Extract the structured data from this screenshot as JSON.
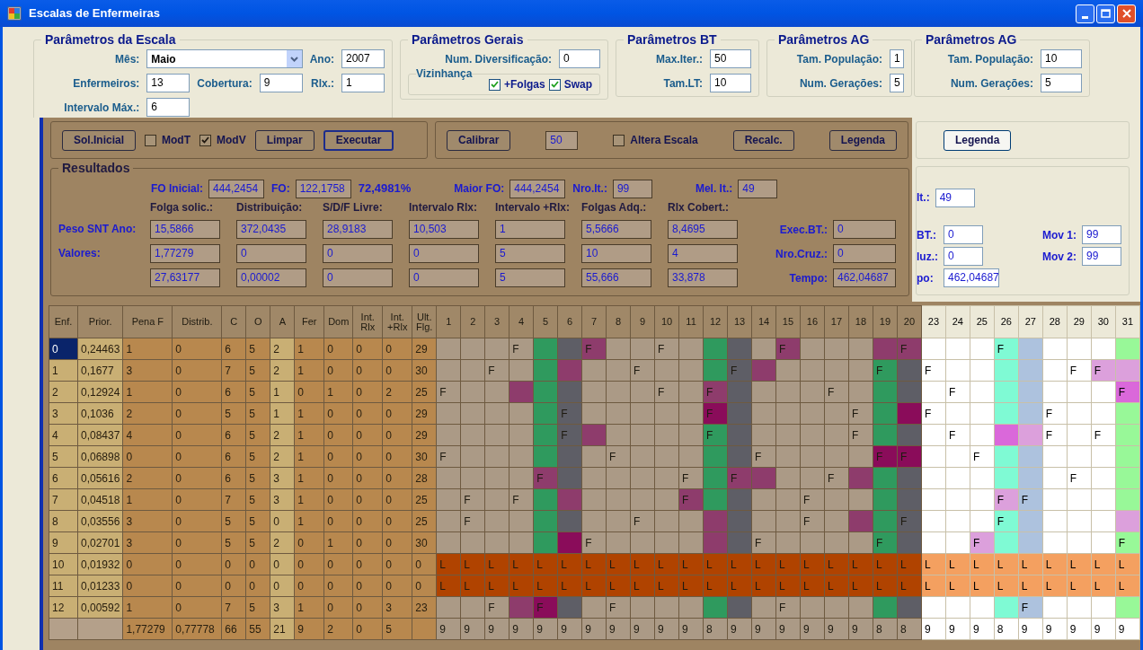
{
  "window": {
    "title": "Escalas de Enfermeiras"
  },
  "parameter_groups": [
    {
      "kind": "escala",
      "title": "Parâmetros da Escala",
      "fields": [
        {
          "label": "Mês:",
          "value": "Maio",
          "kind": "select"
        },
        {
          "label": "Ano:",
          "value": "2007",
          "kind": "text"
        },
        {
          "label": "Enfermeiros:",
          "value": "13",
          "kind": "text"
        },
        {
          "label": "Cobertura:",
          "value": "9",
          "kind": "text"
        },
        {
          "label": "Rlx.:",
          "value": "1",
          "kind": "text"
        },
        {
          "label": "Intervalo Máx.:",
          "value": "6",
          "kind": "text"
        }
      ]
    },
    {
      "kind": "gerais",
      "title": "Parâmetros Gerais",
      "fields": [
        {
          "label": "Num. Diversificação:",
          "value": "0",
          "kind": "text"
        }
      ],
      "vizinhanca": {
        "title": "Vizinhança",
        "options": [
          {
            "label": "+Folgas",
            "checked": true
          },
          {
            "label": "Swap",
            "checked": true
          }
        ]
      }
    },
    {
      "kind": "bt",
      "title": "Parâmetros BT",
      "fields": [
        {
          "label": "Max.Iter.:",
          "value": "50",
          "kind": "text"
        },
        {
          "label": "Tam.LT:",
          "value": "10",
          "kind": "text"
        }
      ]
    },
    {
      "kind": "ag_hidden",
      "title": "Parâmetros AG",
      "fields": [
        {
          "label": "Tam. População:",
          "value": "1",
          "kind": "text"
        },
        {
          "label": "Num. Gerações:",
          "value": "5",
          "kind": "text"
        }
      ]
    },
    {
      "kind": "ag",
      "title": "Parâmetros AG",
      "fields": [
        {
          "label": "Tam. População:",
          "value": "10",
          "kind": "text"
        },
        {
          "label": "Num. Gerações:",
          "value": "5",
          "kind": "text"
        }
      ]
    }
  ],
  "controls": [
    {
      "items": [
        {
          "kind": "button",
          "label": "Sol.Inicial",
          "selected": false
        },
        {
          "kind": "checkbox",
          "label": "ModT",
          "checked": false
        },
        {
          "kind": "checkbox",
          "label": "ModV",
          "checked": true
        },
        {
          "kind": "button",
          "label": "Limpar",
          "selected": false
        },
        {
          "kind": "button",
          "label": "Executar",
          "selected": true
        }
      ]
    },
    {
      "items": [
        {
          "kind": "button",
          "label": "Calibrar",
          "selected": false
        },
        {
          "kind": "field",
          "value": "50"
        },
        {
          "kind": "checkbox",
          "label": "Altera Escala",
          "checked": false
        },
        {
          "kind": "button",
          "label": "Recalc.",
          "selected": false
        },
        {
          "kind": "button",
          "label": "Legenda",
          "selected": false
        }
      ]
    }
  ],
  "legend_button": "Legenda",
  "results": {
    "title": "Resultados",
    "summary": [
      {
        "kind": "field",
        "label": "FO Inicial:",
        "value": "444,2454"
      },
      {
        "kind": "field",
        "label": "FO:",
        "value": "122,1758"
      },
      {
        "kind": "text",
        "value": "72,4981%"
      },
      {
        "kind": "field",
        "label": "Maior FO:",
        "value": "444,2454"
      },
      {
        "kind": "field",
        "label": "Nro.It.:",
        "value": "99"
      },
      {
        "kind": "field",
        "label": "Mel. It.:",
        "value": "49"
      }
    ],
    "columns": [
      "Folga solic.:",
      "Distribuição:",
      "S/D/F Livre:",
      "Intervalo Rlx:",
      "Intervalo +Rlx:",
      "Folgas Adq.:",
      "Rlx Cobert.:"
    ],
    "rows": [
      {
        "label": "Peso SNT Ano:",
        "values": [
          "15,5866",
          "372,0435",
          "28,9183",
          "10,503",
          "1",
          "5,5666",
          "8,4695"
        ],
        "side_label": "Exec.BT.:",
        "side_value": "0"
      },
      {
        "label": "Valores:",
        "values": [
          "1,77279",
          "0",
          "0",
          "0",
          "5",
          "10",
          "4"
        ],
        "side_label": "Nro.Cruz.:",
        "side_value": "0"
      },
      {
        "values": [
          "27,63177",
          "0,00002",
          "0",
          "0",
          "5",
          "55,666",
          "33,878"
        ],
        "side_label": "Tempo:",
        "side_value": "462,04687"
      }
    ]
  },
  "side_results": {
    "top": {
      "label": "It.:",
      "value": "49"
    },
    "rows": [
      {
        "label": "BT.:",
        "value": "0",
        "mov_label": "Mov 1:",
        "mov_value": "99"
      },
      {
        "label": "luz.:",
        "value": "0",
        "mov_label": "Mov 2:",
        "mov_value": "99"
      },
      {
        "label": "po:",
        "value": "462,04687"
      }
    ]
  },
  "table": {
    "columns": [
      "Enf.",
      "Prior.",
      "Pena F",
      "Distrib.",
      "C",
      "O",
      "A",
      "Fer",
      "Dom",
      "Int. Rlx",
      "Int. +Rlx",
      "Ult. Flg.",
      "1",
      "2",
      "3",
      "4",
      "5",
      "6",
      "7",
      "8",
      "9",
      "10",
      "11",
      "12",
      "13",
      "14",
      "15",
      "16",
      "17",
      "18",
      "19",
      "20",
      "23",
      "24",
      "25",
      "26",
      "27",
      "28",
      "29",
      "30",
      "31"
    ],
    "rows": [
      {
        "selected": true,
        "cells": [
          "0",
          "0,24463",
          "1",
          "0",
          "6",
          "5",
          "2",
          "1",
          "0",
          "0",
          "0",
          "29"
        ],
        "days": [
          {
            "color": "#ab9a86"
          },
          {
            "color": "#ab9a86"
          },
          {
            "color": "#ab9a86"
          },
          {
            "text": "F",
            "color": "#ab9a86"
          },
          {
            "color": "#2f9a5e"
          },
          {
            "color": "#5e5e66"
          },
          {
            "text": "F",
            "color": "#8e3c6c"
          },
          {
            "color": "#ab9a86"
          },
          {
            "color": "#ab9a86"
          },
          {
            "text": "F",
            "color": "#ab9a86"
          },
          {
            "color": "#ab9a86"
          },
          {
            "color": "#2f9a5e"
          },
          {
            "color": "#5e5e66"
          },
          {
            "color": "#ab9a86"
          },
          {
            "text": "F",
            "color": "#8e3c6c"
          },
          {
            "color": "#ab9a86"
          },
          {
            "color": "#ab9a86"
          },
          {
            "color": "#ab9a86"
          },
          {
            "color": "#8e3c6c"
          },
          {
            "text": "F",
            "color": "#8e3c6c"
          },
          {
            "color": "#ffffff"
          },
          {
            "color": "#ffffff"
          },
          {
            "color": "#ffffff"
          },
          {
            "text": "F",
            "color": "#7ffad4"
          },
          {
            "color": "#adc2de"
          },
          {
            "color": "#ffffff"
          },
          {
            "color": "#ffffff"
          },
          {
            "color": "#ffffff"
          },
          {
            "color": "#98f898"
          }
        ]
      },
      {
        "selected": false,
        "cells": [
          "1",
          "0,1677",
          "3",
          "0",
          "7",
          "5",
          "2",
          "1",
          "0",
          "0",
          "0",
          "30"
        ],
        "days": [
          {
            "color": "#ab9a86"
          },
          {
            "color": "#ab9a86"
          },
          {
            "text": "F",
            "color": "#ab9a86"
          },
          {
            "color": "#ab9a86"
          },
          {
            "color": "#2f9a5e"
          },
          {
            "color": "#8e3c6c"
          },
          {
            "color": "#ab9a86"
          },
          {
            "color": "#ab9a86"
          },
          {
            "text": "F",
            "color": "#ab9a86"
          },
          {
            "color": "#ab9a86"
          },
          {
            "color": "#ab9a86"
          },
          {
            "color": "#2f9a5e"
          },
          {
            "text": "F",
            "color": "#5e5e66"
          },
          {
            "color": "#8e3c6c"
          },
          {
            "color": "#ab9a86"
          },
          {
            "color": "#ab9a86"
          },
          {
            "color": "#ab9a86"
          },
          {
            "color": "#ab9a86"
          },
          {
            "text": "F",
            "color": "#2f9a5e"
          },
          {
            "color": "#5e5e66"
          },
          {
            "text": "F",
            "color": "#ffffff"
          },
          {
            "color": "#ffffff"
          },
          {
            "color": "#ffffff"
          },
          {
            "color": "#7ffad4"
          },
          {
            "color": "#adc2de"
          },
          {
            "color": "#ffffff"
          },
          {
            "text": "F",
            "color": "#ffffff"
          },
          {
            "text": "F",
            "color": "#dca0dc"
          },
          {
            "color": "#dca0dc"
          }
        ]
      },
      {
        "selected": false,
        "cells": [
          "2",
          "0,12924",
          "1",
          "0",
          "6",
          "5",
          "1",
          "0",
          "1",
          "0",
          "2",
          "25"
        ],
        "days": [
          {
            "text": "F",
            "color": "#ab9a86"
          },
          {
            "color": "#ab9a86"
          },
          {
            "color": "#ab9a86"
          },
          {
            "color": "#8e3c6c"
          },
          {
            "color": "#2f9a5e"
          },
          {
            "color": "#5e5e66"
          },
          {
            "color": "#ab9a86"
          },
          {
            "color": "#ab9a86"
          },
          {
            "color": "#ab9a86"
          },
          {
            "text": "F",
            "color": "#ab9a86"
          },
          {
            "color": "#ab9a86"
          },
          {
            "text": "F",
            "color": "#8e3c6c"
          },
          {
            "color": "#5e5e66"
          },
          {
            "color": "#ab9a86"
          },
          {
            "color": "#ab9a86"
          },
          {
            "color": "#ab9a86"
          },
          {
            "text": "F",
            "color": "#ab9a86"
          },
          {
            "color": "#ab9a86"
          },
          {
            "color": "#2f9a5e"
          },
          {
            "color": "#5e5e66"
          },
          {
            "color": "#ffffff"
          },
          {
            "text": "F",
            "color": "#ffffff"
          },
          {
            "color": "#ffffff"
          },
          {
            "color": "#7ffad4"
          },
          {
            "color": "#adc2de"
          },
          {
            "color": "#ffffff"
          },
          {
            "color": "#ffffff"
          },
          {
            "color": "#ffffff"
          },
          {
            "text": "F",
            "color": "#da68da"
          }
        ]
      },
      {
        "selected": false,
        "cells": [
          "3",
          "0,1036",
          "2",
          "0",
          "5",
          "5",
          "1",
          "1",
          "0",
          "0",
          "0",
          "29"
        ],
        "days": [
          {
            "color": "#ab9a86"
          },
          {
            "color": "#ab9a86"
          },
          {
            "color": "#ab9a86"
          },
          {
            "color": "#ab9a86"
          },
          {
            "color": "#2f9a5e"
          },
          {
            "text": "F",
            "color": "#5e5e66"
          },
          {
            "color": "#ab9a86"
          },
          {
            "color": "#ab9a86"
          },
          {
            "color": "#ab9a86"
          },
          {
            "color": "#ab9a86"
          },
          {
            "color": "#ab9a86"
          },
          {
            "text": "F",
            "color": "#8a0c5a"
          },
          {
            "color": "#5e5e66"
          },
          {
            "color": "#ab9a86"
          },
          {
            "color": "#ab9a86"
          },
          {
            "color": "#ab9a86"
          },
          {
            "color": "#ab9a86"
          },
          {
            "text": "F",
            "color": "#ab9a86"
          },
          {
            "color": "#2f9a5e"
          },
          {
            "color": "#8a0c5a"
          },
          {
            "text": "F",
            "color": "#ffffff"
          },
          {
            "color": "#ffffff"
          },
          {
            "color": "#ffffff"
          },
          {
            "color": "#7ffad4"
          },
          {
            "color": "#adc2de"
          },
          {
            "text": "F",
            "color": "#ffffff"
          },
          {
            "color": "#ffffff"
          },
          {
            "color": "#ffffff"
          },
          {
            "color": "#98f898"
          }
        ]
      },
      {
        "selected": false,
        "cells": [
          "4",
          "0,08437",
          "4",
          "0",
          "6",
          "5",
          "2",
          "1",
          "0",
          "0",
          "0",
          "29"
        ],
        "days": [
          {
            "color": "#ab9a86"
          },
          {
            "color": "#ab9a86"
          },
          {
            "color": "#ab9a86"
          },
          {
            "color": "#ab9a86"
          },
          {
            "color": "#2f9a5e"
          },
          {
            "text": "F",
            "color": "#5e5e66"
          },
          {
            "color": "#8e3c6c"
          },
          {
            "color": "#ab9a86"
          },
          {
            "color": "#ab9a86"
          },
          {
            "color": "#ab9a86"
          },
          {
            "color": "#ab9a86"
          },
          {
            "text": "F",
            "color": "#2f9a5e"
          },
          {
            "color": "#5e5e66"
          },
          {
            "color": "#ab9a86"
          },
          {
            "color": "#ab9a86"
          },
          {
            "color": "#ab9a86"
          },
          {
            "color": "#ab9a86"
          },
          {
            "text": "F",
            "color": "#ab9a86"
          },
          {
            "color": "#2f9a5e"
          },
          {
            "color": "#5e5e66"
          },
          {
            "color": "#ffffff"
          },
          {
            "text": "F",
            "color": "#ffffff"
          },
          {
            "color": "#ffffff"
          },
          {
            "color": "#da68da"
          },
          {
            "color": "#dca0dc"
          },
          {
            "text": "F",
            "color": "#ffffff"
          },
          {
            "color": "#ffffff"
          },
          {
            "text": "F",
            "color": "#ffffff"
          },
          {
            "color": "#98f898"
          }
        ]
      },
      {
        "selected": false,
        "cells": [
          "5",
          "0,06898",
          "0",
          "0",
          "6",
          "5",
          "2",
          "1",
          "0",
          "0",
          "0",
          "30"
        ],
        "days": [
          {
            "text": "F",
            "color": "#ab9a86"
          },
          {
            "color": "#ab9a86"
          },
          {
            "color": "#ab9a86"
          },
          {
            "color": "#ab9a86"
          },
          {
            "color": "#2f9a5e"
          },
          {
            "color": "#5e5e66"
          },
          {
            "color": "#ab9a86"
          },
          {
            "text": "F",
            "color": "#ab9a86"
          },
          {
            "color": "#ab9a86"
          },
          {
            "color": "#ab9a86"
          },
          {
            "color": "#ab9a86"
          },
          {
            "color": "#2f9a5e"
          },
          {
            "color": "#5e5e66"
          },
          {
            "text": "F",
            "color": "#ab9a86"
          },
          {
            "color": "#ab9a86"
          },
          {
            "color": "#ab9a86"
          },
          {
            "color": "#ab9a86"
          },
          {
            "color": "#ab9a86"
          },
          {
            "text": "F",
            "color": "#8a0c5a"
          },
          {
            "text": "F",
            "color": "#8a0c5a"
          },
          {
            "color": "#ffffff"
          },
          {
            "color": "#ffffff"
          },
          {
            "text": "F",
            "color": "#ffffff"
          },
          {
            "color": "#7ffad4"
          },
          {
            "color": "#adc2de"
          },
          {
            "color": "#ffffff"
          },
          {
            "color": "#ffffff"
          },
          {
            "color": "#ffffff"
          },
          {
            "color": "#98f898"
          }
        ]
      },
      {
        "selected": false,
        "cells": [
          "6",
          "0,05616",
          "2",
          "0",
          "6",
          "5",
          "3",
          "1",
          "0",
          "0",
          "0",
          "28"
        ],
        "days": [
          {
            "color": "#ab9a86"
          },
          {
            "color": "#ab9a86"
          },
          {
            "color": "#ab9a86"
          },
          {
            "color": "#ab9a86"
          },
          {
            "text": "F",
            "color": "#8e3c6c"
          },
          {
            "color": "#5e5e66"
          },
          {
            "color": "#ab9a86"
          },
          {
            "color": "#ab9a86"
          },
          {
            "color": "#ab9a86"
          },
          {
            "color": "#ab9a86"
          },
          {
            "text": "F",
            "color": "#ab9a86"
          },
          {
            "color": "#2f9a5e"
          },
          {
            "text": "F",
            "color": "#8e3c6c"
          },
          {
            "color": "#8e3c6c"
          },
          {
            "color": "#ab9a86"
          },
          {
            "color": "#ab9a86"
          },
          {
            "text": "F",
            "color": "#ab9a86"
          },
          {
            "color": "#8e3c6c"
          },
          {
            "color": "#2f9a5e"
          },
          {
            "color": "#5e5e66"
          },
          {
            "color": "#ffffff"
          },
          {
            "color": "#ffffff"
          },
          {
            "color": "#ffffff"
          },
          {
            "color": "#7ffad4"
          },
          {
            "color": "#adc2de"
          },
          {
            "color": "#ffffff"
          },
          {
            "text": "F",
            "color": "#ffffff"
          },
          {
            "color": "#ffffff"
          },
          {
            "color": "#98f898"
          }
        ]
      },
      {
        "selected": false,
        "cells": [
          "7",
          "0,04518",
          "1",
          "0",
          "7",
          "5",
          "3",
          "1",
          "0",
          "0",
          "0",
          "25"
        ],
        "days": [
          {
            "color": "#ab9a86"
          },
          {
            "text": "F",
            "color": "#ab9a86"
          },
          {
            "color": "#ab9a86"
          },
          {
            "text": "F",
            "color": "#ab9a86"
          },
          {
            "color": "#2f9a5e"
          },
          {
            "color": "#8e3c6c"
          },
          {
            "color": "#ab9a86"
          },
          {
            "color": "#ab9a86"
          },
          {
            "color": "#ab9a86"
          },
          {
            "color": "#ab9a86"
          },
          {
            "text": "F",
            "color": "#8e3c6c"
          },
          {
            "color": "#2f9a5e"
          },
          {
            "color": "#5e5e66"
          },
          {
            "color": "#ab9a86"
          },
          {
            "color": "#ab9a86"
          },
          {
            "text": "F",
            "color": "#ab9a86"
          },
          {
            "color": "#ab9a86"
          },
          {
            "color": "#ab9a86"
          },
          {
            "color": "#2f9a5e"
          },
          {
            "color": "#5e5e66"
          },
          {
            "color": "#ffffff"
          },
          {
            "color": "#ffffff"
          },
          {
            "color": "#ffffff"
          },
          {
            "text": "F",
            "color": "#dca0dc"
          },
          {
            "text": "F",
            "color": "#adc2de"
          },
          {
            "color": "#ffffff"
          },
          {
            "color": "#ffffff"
          },
          {
            "color": "#ffffff"
          },
          {
            "color": "#98f898"
          }
        ]
      },
      {
        "selected": false,
        "cells": [
          "8",
          "0,03556",
          "3",
          "0",
          "5",
          "5",
          "0",
          "1",
          "0",
          "0",
          "0",
          "25"
        ],
        "days": [
          {
            "color": "#ab9a86"
          },
          {
            "text": "F",
            "color": "#ab9a86"
          },
          {
            "color": "#ab9a86"
          },
          {
            "color": "#ab9a86"
          },
          {
            "color": "#2f9a5e"
          },
          {
            "color": "#5e5e66"
          },
          {
            "color": "#ab9a86"
          },
          {
            "color": "#ab9a86"
          },
          {
            "text": "F",
            "color": "#ab9a86"
          },
          {
            "color": "#ab9a86"
          },
          {
            "color": "#ab9a86"
          },
          {
            "color": "#8e3c6c"
          },
          {
            "color": "#5e5e66"
          },
          {
            "color": "#ab9a86"
          },
          {
            "color": "#ab9a86"
          },
          {
            "text": "F",
            "color": "#ab9a86"
          },
          {
            "color": "#ab9a86"
          },
          {
            "color": "#8e3c6c"
          },
          {
            "color": "#2f9a5e"
          },
          {
            "text": "F",
            "color": "#5e5e66"
          },
          {
            "color": "#ffffff"
          },
          {
            "color": "#ffffff"
          },
          {
            "color": "#ffffff"
          },
          {
            "text": "F",
            "color": "#7ffad4"
          },
          {
            "color": "#adc2de"
          },
          {
            "color": "#ffffff"
          },
          {
            "color": "#ffffff"
          },
          {
            "color": "#ffffff"
          },
          {
            "color": "#dca0dc"
          }
        ]
      },
      {
        "selected": false,
        "cells": [
          "9",
          "0,02701",
          "3",
          "0",
          "5",
          "5",
          "2",
          "0",
          "1",
          "0",
          "0",
          "30"
        ],
        "days": [
          {
            "color": "#ab9a86"
          },
          {
            "color": "#ab9a86"
          },
          {
            "color": "#ab9a86"
          },
          {
            "color": "#ab9a86"
          },
          {
            "color": "#2f9a5e"
          },
          {
            "color": "#8a0c5a"
          },
          {
            "text": "F",
            "color": "#ab9a86"
          },
          {
            "color": "#ab9a86"
          },
          {
            "color": "#ab9a86"
          },
          {
            "color": "#ab9a86"
          },
          {
            "color": "#ab9a86"
          },
          {
            "color": "#8e3c6c"
          },
          {
            "color": "#5e5e66"
          },
          {
            "text": "F",
            "color": "#ab9a86"
          },
          {
            "color": "#ab9a86"
          },
          {
            "color": "#ab9a86"
          },
          {
            "color": "#ab9a86"
          },
          {
            "color": "#ab9a86"
          },
          {
            "text": "F",
            "color": "#2f9a5e"
          },
          {
            "color": "#5e5e66"
          },
          {
            "color": "#ffffff"
          },
          {
            "color": "#ffffff"
          },
          {
            "text": "F",
            "color": "#dca0dc"
          },
          {
            "color": "#7ffad4"
          },
          {
            "color": "#adc2de"
          },
          {
            "color": "#ffffff"
          },
          {
            "color": "#ffffff"
          },
          {
            "color": "#ffffff"
          },
          {
            "text": "F",
            "color": "#98f898"
          }
        ]
      },
      {
        "selected": false,
        "cells": [
          "10",
          "0,01932",
          "0",
          "0",
          "0",
          "0",
          "0",
          "0",
          "0",
          "0",
          "0",
          "0"
        ],
        "days": [
          {
            "text": "L",
            "color": "#b04300"
          },
          {
            "text": "L",
            "color": "#b04300"
          },
          {
            "text": "L",
            "color": "#b04300"
          },
          {
            "text": "L",
            "color": "#b04300"
          },
          {
            "text": "L",
            "color": "#b04300"
          },
          {
            "text": "L",
            "color": "#b04300"
          },
          {
            "text": "L",
            "color": "#b04300"
          },
          {
            "text": "L",
            "color": "#b04300"
          },
          {
            "text": "L",
            "color": "#b04300"
          },
          {
            "text": "L",
            "color": "#b04300"
          },
          {
            "text": "L",
            "color": "#b04300"
          },
          {
            "text": "L",
            "color": "#b04300"
          },
          {
            "text": "L",
            "color": "#b04300"
          },
          {
            "text": "L",
            "color": "#b04300"
          },
          {
            "text": "L",
            "color": "#b04300"
          },
          {
            "text": "L",
            "color": "#b04300"
          },
          {
            "text": "L",
            "color": "#b04300"
          },
          {
            "text": "L",
            "color": "#b04300"
          },
          {
            "text": "L",
            "color": "#b04300"
          },
          {
            "text": "L",
            "color": "#b04300"
          },
          {
            "text": "L",
            "color": "#f4a060"
          },
          {
            "text": "L",
            "color": "#f4a060"
          },
          {
            "text": "L",
            "color": "#f4a060"
          },
          {
            "text": "L",
            "color": "#f4a060"
          },
          {
            "text": "L",
            "color": "#f4a060"
          },
          {
            "text": "L",
            "color": "#f4a060"
          },
          {
            "text": "L",
            "color": "#f4a060"
          },
          {
            "text": "L",
            "color": "#f4a060"
          },
          {
            "text": "L",
            "color": "#f4a060"
          }
        ]
      },
      {
        "selected": false,
        "cells": [
          "11",
          "0,01233",
          "0",
          "0",
          "0",
          "0",
          "0",
          "0",
          "0",
          "0",
          "0",
          "0"
        ],
        "days": [
          {
            "text": "L",
            "color": "#b04300"
          },
          {
            "text": "L",
            "color": "#b04300"
          },
          {
            "text": "L",
            "color": "#b04300"
          },
          {
            "text": "L",
            "color": "#b04300"
          },
          {
            "text": "L",
            "color": "#b04300"
          },
          {
            "text": "L",
            "color": "#b04300"
          },
          {
            "text": "L",
            "color": "#b04300"
          },
          {
            "text": "L",
            "color": "#b04300"
          },
          {
            "text": "L",
            "color": "#b04300"
          },
          {
            "text": "L",
            "color": "#b04300"
          },
          {
            "text": "L",
            "color": "#b04300"
          },
          {
            "text": "L",
            "color": "#b04300"
          },
          {
            "text": "L",
            "color": "#b04300"
          },
          {
            "text": "L",
            "color": "#b04300"
          },
          {
            "text": "L",
            "color": "#b04300"
          },
          {
            "text": "L",
            "color": "#b04300"
          },
          {
            "text": "L",
            "color": "#b04300"
          },
          {
            "text": "L",
            "color": "#b04300"
          },
          {
            "text": "L",
            "color": "#b04300"
          },
          {
            "text": "L",
            "color": "#b04300"
          },
          {
            "text": "L",
            "color": "#f4a060"
          },
          {
            "text": "L",
            "color": "#f4a060"
          },
          {
            "text": "L",
            "color": "#f4a060"
          },
          {
            "text": "L",
            "color": "#f4a060"
          },
          {
            "text": "L",
            "color": "#f4a060"
          },
          {
            "text": "L",
            "color": "#f4a060"
          },
          {
            "text": "L",
            "color": "#f4a060"
          },
          {
            "text": "L",
            "color": "#f4a060"
          },
          {
            "text": "L",
            "color": "#f4a060"
          }
        ]
      },
      {
        "selected": false,
        "cells": [
          "12",
          "0,00592",
          "1",
          "0",
          "7",
          "5",
          "3",
          "1",
          "0",
          "0",
          "3",
          "23"
        ],
        "days": [
          {
            "color": "#ab9a86"
          },
          {
            "color": "#ab9a86"
          },
          {
            "text": "F",
            "color": "#ab9a86"
          },
          {
            "color": "#8e3c6c"
          },
          {
            "text": "F",
            "color": "#8a0c5a"
          },
          {
            "color": "#5e5e66"
          },
          {
            "color": "#ab9a86"
          },
          {
            "text": "F",
            "color": "#ab9a86"
          },
          {
            "color": "#ab9a86"
          },
          {
            "color": "#ab9a86"
          },
          {
            "color": "#ab9a86"
          },
          {
            "color": "#2f9a5e"
          },
          {
            "color": "#5e5e66"
          },
          {
            "color": "#ab9a86"
          },
          {
            "text": "F",
            "color": "#ab9a86"
          },
          {
            "color": "#ab9a86"
          },
          {
            "color": "#ab9a86"
          },
          {
            "color": "#ab9a86"
          },
          {
            "color": "#2f9a5e"
          },
          {
            "color": "#5e5e66"
          },
          {
            "color": "#ffffff"
          },
          {
            "color": "#ffffff"
          },
          {
            "color": "#ffffff"
          },
          {
            "color": "#7ffad4"
          },
          {
            "text": "F",
            "color": "#adc2de"
          },
          {
            "color": "#ffffff"
          },
          {
            "color": "#ffffff"
          },
          {
            "color": "#ffffff"
          },
          {
            "color": "#98f898"
          }
        ]
      }
    ],
    "totals": [
      "1,77279",
      "0,77778",
      "66",
      "55",
      "21",
      "9",
      "2",
      "0",
      "5"
    ],
    "day_totals": [
      "9",
      "9",
      "9",
      "9",
      "9",
      "9",
      "9",
      "9",
      "9",
      "9",
      "9",
      "8",
      "9",
      "9",
      "9",
      "9",
      "9",
      "9",
      "8",
      "8",
      "9",
      "9",
      "9",
      "8",
      "9",
      "9",
      "9",
      "9",
      "9"
    ]
  }
}
